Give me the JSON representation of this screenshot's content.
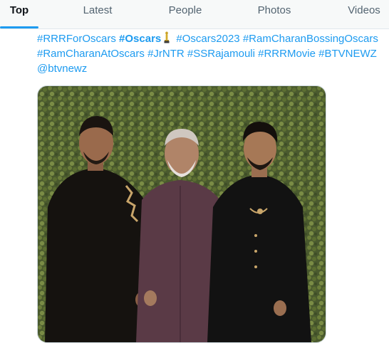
{
  "tabs": [
    {
      "label": "Top",
      "active": true
    },
    {
      "label": "Latest",
      "active": false
    },
    {
      "label": "People",
      "active": false
    },
    {
      "label": "Photos",
      "active": false
    },
    {
      "label": "Videos",
      "active": false
    }
  ],
  "tweet": {
    "line1": {
      "tag1": "#RRRForOscars",
      "tag2": "#Oscars",
      "emoji": "oscar-trophy-icon",
      "tag3": "#Oscars2023",
      "tag4": "#RamCharanBossingOscars"
    },
    "line2": {
      "tag1": "#RamCharanAtOscars",
      "tag2": "#JrNTR",
      "tag3": "#SSRajamouli",
      "tag4": "#RRRMovie",
      "tag5": "#BTVNEWZ"
    },
    "line3": {
      "mention": "@btvnewz"
    }
  },
  "media": {
    "type": "photo",
    "description": "three-men-posing-in-front-of-hedge-wall"
  },
  "colors": {
    "accent": "#1d9bf0",
    "tab_bar_bg": "#f7f9f9",
    "text_primary": "#0f1419",
    "text_secondary": "#536471"
  }
}
